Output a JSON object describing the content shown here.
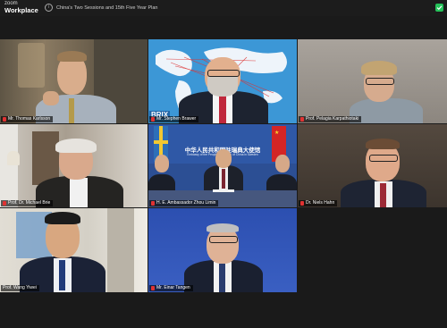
{
  "app": {
    "logo_top": "zoom",
    "logo_bottom": "Workplace",
    "meeting_title": "China's Two Sessions and 15th Five Year Plan"
  },
  "participants": [
    {
      "name": "Mr. Thomas Karlsson"
    },
    {
      "name": "Mr. Stephen Brawer"
    },
    {
      "name": "Prof. Pelagia Karpathiotaki"
    },
    {
      "name": "Prof. Dr. Michael Brie"
    },
    {
      "name": "H. E. Ambassador Zhou Limin"
    },
    {
      "name": "Dr. Niels Hahn"
    },
    {
      "name": "Prof. Wang Yiwei"
    },
    {
      "name": "Mr. Einar Tangen"
    }
  ],
  "embassy": {
    "chinese_text": "中华人民共和国驻瑞典大使馆",
    "english_line1": "Embassy of the People's Republic of China in Sweden"
  },
  "brics_text": "BRIX",
  "colors": {
    "accent_green": "#25c25a",
    "mic_red": "#e03232",
    "background": "#1a1a1a"
  }
}
